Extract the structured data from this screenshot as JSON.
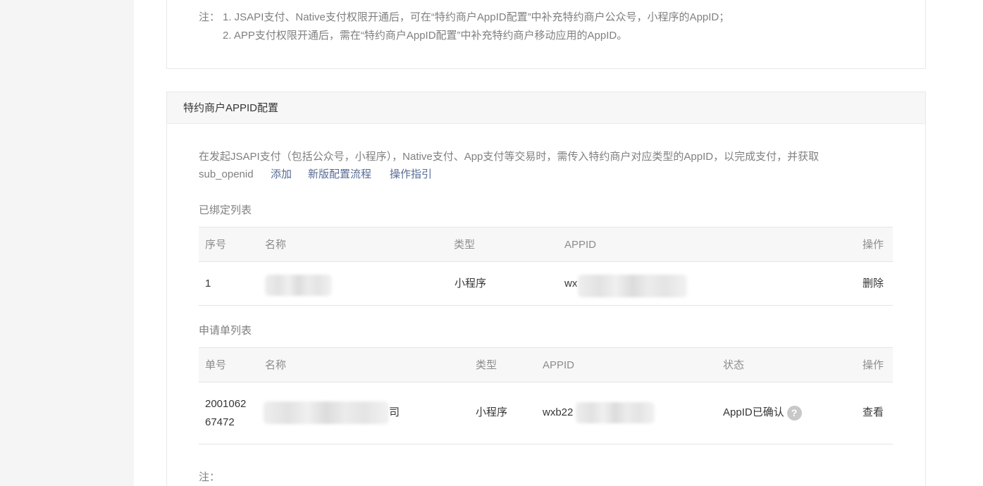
{
  "top_notes": {
    "label": "注：",
    "line1": "1. JSAPI支付、Native支付权限开通后，可在“特约商户AppID配置”中补充特约商户公众号，小程序的AppID；",
    "line2": "2. APP支付权限开通后，需在“特约商户AppID配置”中补充特约商户移动应用的AppID。"
  },
  "card": {
    "title": "特约商户APPID配置",
    "description_line1": "在发起JSAPI支付（包括公众号，小程序），Native支付、App支付等交易时，需传入特约商户对应类型的AppID，以完成支付，并获取",
    "description_line2": "sub_openid",
    "links": {
      "add": "添加",
      "new_flow": "新版配置流程",
      "guide": "操作指引"
    }
  },
  "bound_list": {
    "label": "已绑定列表",
    "headers": [
      "序号",
      "名称",
      "类型",
      "APPID",
      "操作"
    ],
    "rows": [
      {
        "index": "1",
        "name": "",
        "type": "小程序",
        "appid": "wx",
        "action": "删除"
      }
    ]
  },
  "application_list": {
    "label": "申请单列表",
    "headers": [
      "单号",
      "名称",
      "类型",
      "APPID",
      "状态",
      "操作"
    ],
    "rows": [
      {
        "number_line1": "2001062",
        "number_line2": "67472",
        "name_suffix": "司",
        "type": "小程序",
        "appid": "wxb22",
        "status": "AppID已确认",
        "help": "?",
        "action": "查看"
      }
    ]
  },
  "bottom_note": {
    "label": "注："
  },
  "colors": {
    "link": "#576b95",
    "muted_text": "#808080",
    "header_bg": "#f7f7f7",
    "sidebar_bg": "#f5f5f5"
  },
  "icons": {
    "help": "question-circle-icon"
  }
}
